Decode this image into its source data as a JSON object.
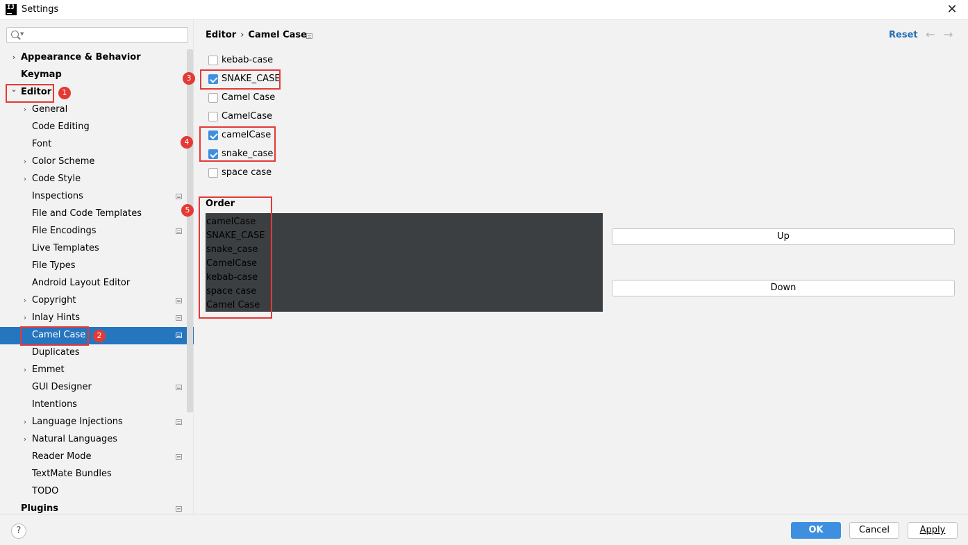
{
  "window": {
    "title": "Settings",
    "app_icon": "intellij-logo-icon",
    "close_glyph": "✕"
  },
  "search": {
    "placeholder": ""
  },
  "sidebar": {
    "items": [
      {
        "label": "Appearance & Behavior",
        "expandable": true,
        "expanded": false,
        "bold": true,
        "level": 0
      },
      {
        "label": "Keymap",
        "expandable": false,
        "bold": true,
        "level": 0
      },
      {
        "label": "Editor",
        "expandable": true,
        "expanded": true,
        "bold": true,
        "level": 0
      },
      {
        "label": "General",
        "expandable": true,
        "level": 1
      },
      {
        "label": "Code Editing",
        "level": 1
      },
      {
        "label": "Font",
        "level": 1
      },
      {
        "label": "Color Scheme",
        "expandable": true,
        "level": 1
      },
      {
        "label": "Code Style",
        "expandable": true,
        "level": 1
      },
      {
        "label": "Inspections",
        "level": 1,
        "project_icon": true
      },
      {
        "label": "File and Code Templates",
        "level": 1
      },
      {
        "label": "File Encodings",
        "level": 1,
        "project_icon": true
      },
      {
        "label": "Live Templates",
        "level": 1
      },
      {
        "label": "File Types",
        "level": 1
      },
      {
        "label": "Android Layout Editor",
        "level": 1
      },
      {
        "label": "Copyright",
        "expandable": true,
        "level": 1,
        "project_icon": true
      },
      {
        "label": "Inlay Hints",
        "expandable": true,
        "level": 1,
        "project_icon": true
      },
      {
        "label": "Camel Case",
        "level": 1,
        "project_icon": true,
        "selected": true
      },
      {
        "label": "Duplicates",
        "level": 1
      },
      {
        "label": "Emmet",
        "expandable": true,
        "level": 1
      },
      {
        "label": "GUI Designer",
        "level": 1,
        "project_icon": true
      },
      {
        "label": "Intentions",
        "level": 1
      },
      {
        "label": "Language Injections",
        "expandable": true,
        "level": 1,
        "project_icon": true
      },
      {
        "label": "Natural Languages",
        "expandable": true,
        "level": 1
      },
      {
        "label": "Reader Mode",
        "level": 1,
        "project_icon": true
      },
      {
        "label": "TextMate Bundles",
        "level": 1
      },
      {
        "label": "TODO",
        "level": 1
      },
      {
        "label": "Plugins",
        "bold": true,
        "level": 0,
        "project_icon": true
      }
    ]
  },
  "annotations": [
    "1",
    "2",
    "3",
    "4",
    "5"
  ],
  "breadcrumb": {
    "parent": "Editor",
    "separator": "›",
    "current": "Camel Case"
  },
  "header": {
    "reset_label": "Reset",
    "back_glyph": "←",
    "forward_glyph": "→"
  },
  "options": [
    {
      "label": "kebab-case",
      "checked": false
    },
    {
      "label": "SNAKE_CASE",
      "checked": true
    },
    {
      "label": "Camel Case",
      "checked": false
    },
    {
      "label": "CamelCase",
      "checked": false
    },
    {
      "label": "camelCase",
      "checked": true
    },
    {
      "label": "snake_case",
      "checked": true
    },
    {
      "label": "space case",
      "checked": false
    }
  ],
  "order": {
    "title": "Order",
    "items": [
      "camelCase",
      "SNAKE_CASE",
      "snake_case",
      "CamelCase",
      "kebab-case",
      "space case",
      "Camel Case"
    ],
    "up_label": "Up",
    "down_label": "Down"
  },
  "footer": {
    "help_glyph": "?",
    "ok_label": "OK",
    "cancel_label": "Cancel",
    "apply_label": "Apply"
  },
  "colors": {
    "accent": "#2675bf",
    "annotation_red": "#e53935",
    "link": "#2470b3",
    "checkbox_checked": "#3d8fe0",
    "list_bg": "#3c3f41"
  }
}
